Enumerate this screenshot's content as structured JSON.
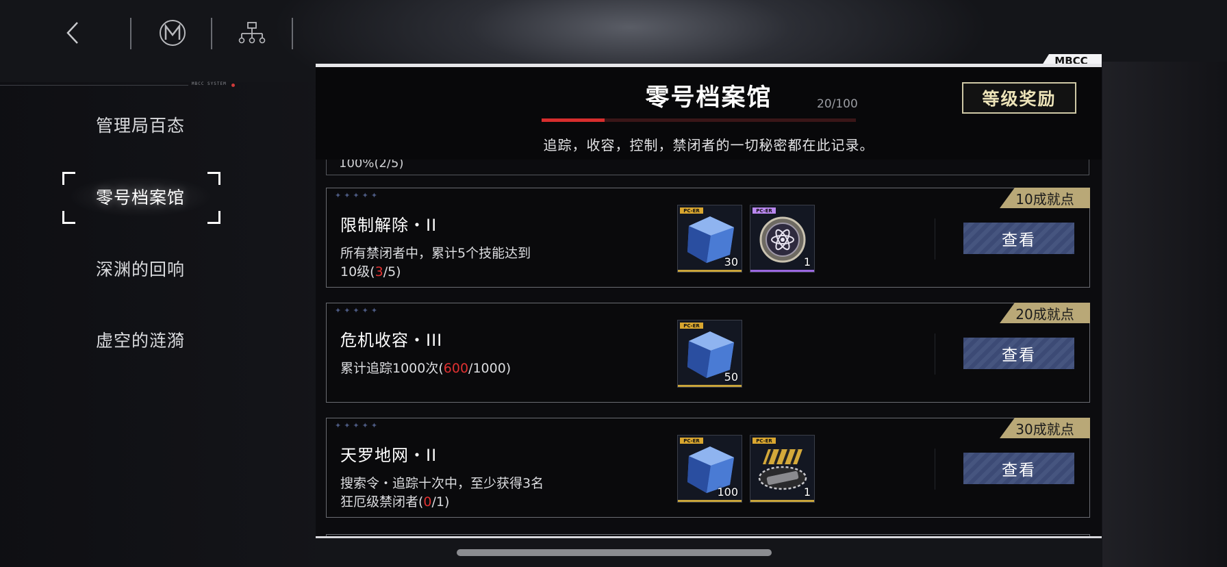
{
  "top_nav": {
    "back_icon": "chevron-left-icon",
    "logo_icon": "m-emblem-icon",
    "tree_icon": "hierarchy-icon",
    "system_label": "MBCC SYSTEM"
  },
  "sidebar": {
    "items": [
      {
        "label": "管理局百态",
        "active": false
      },
      {
        "label": "零号档案馆",
        "active": true
      },
      {
        "label": "深渊的回响",
        "active": false
      },
      {
        "label": "虚空的涟漪",
        "active": false
      }
    ]
  },
  "panel": {
    "tag": "MBCC",
    "title": "零号档案馆",
    "progress_text": "20/100",
    "progress_fraction": 0.2,
    "subtitle": "追踪，收容，控制，禁闭者的一切秘密都在此记录。",
    "reward_button": "等级奖励",
    "partial_row_text": "100%(2/5)",
    "view_button": "查看",
    "achievements": [
      {
        "badge": "10成就点",
        "title": "限制解除・II",
        "desc_prefix": "所有禁闭者中，累计5个技能达到",
        "desc_line2_prefix": "10级(",
        "progress_current": "3",
        "progress_total": "/5)",
        "rewards": [
          {
            "icon": "blue-crystal-cube-icon",
            "qty": "30",
            "rarity_color": "#c9a43a"
          },
          {
            "icon": "atom-emblem-coin-icon",
            "qty": "1",
            "rarity_color": "#9b67e0"
          }
        ]
      },
      {
        "badge": "20成就点",
        "title": "危机收容・III",
        "desc_prefix": "累计追踪1000次(",
        "desc_line2_prefix": "",
        "progress_current": "600",
        "progress_total": "/1000)",
        "rewards": [
          {
            "icon": "blue-crystal-cube-icon",
            "qty": "50",
            "rarity_color": "#c9a43a"
          }
        ]
      },
      {
        "badge": "30成就点",
        "title": "天罗地网・II",
        "desc_prefix": "搜索令・追踪十次中，至少获得3名",
        "desc_line2_prefix": "狂厄级禁闭者(",
        "progress_current": "0",
        "progress_total": "/1)",
        "rewards": [
          {
            "icon": "blue-crystal-cube-icon",
            "qty": "100",
            "rarity_color": "#c9a43a"
          },
          {
            "icon": "classified-ticket-icon",
            "qty": "1",
            "rarity_color": "#c9a43a"
          }
        ]
      }
    ]
  },
  "item_tag": "PC-ER",
  "colors": {
    "accent_red": "#d72d2d",
    "badge_gold": "#b9a877",
    "button_blue": "#3c4a75"
  }
}
